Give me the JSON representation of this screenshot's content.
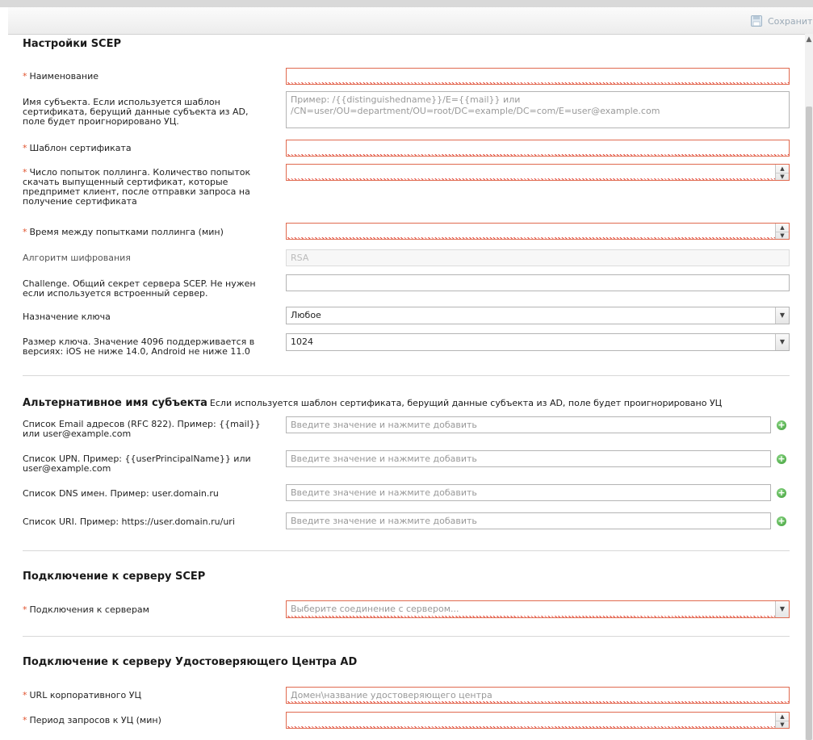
{
  "toolbar": {
    "save_label": "Сохранить"
  },
  "scep": {
    "title": "Настройки SCEP",
    "name_label": "Наименование",
    "subject_label": "Имя субъекта. Если используется шаблон сертификата, берущий данные субъекта из AD, поле будет проигнорировано УЦ.",
    "subject_placeholder": "Пример: /{{distinguishedname}}/E={{mail}} или /CN=user/OU=department/OU=root/DC=example/DC=com/E=user@example.com",
    "template_label": "Шаблон сертификата",
    "polling_attempts_label": "Число попыток поллинга. Количество попыток скачать выпущенный сертификат, которые предпримет клиент, после отправки запроса на получение сертификата",
    "polling_interval_label": "Время между попытками поллинга (мин)",
    "algorithm_label": "Алгоритм шифрования",
    "algorithm_value": "RSA",
    "challenge_label": "Challenge. Общий секрет сервера SCEP. Не нужен если используется встроенный сервер.",
    "key_purpose_label": "Назначение ключа",
    "key_purpose_value": "Любое",
    "key_size_label": "Размер ключа. Значение 4096 поддерживается в версиях: iOS не ниже 14.0, Android не ниже 11.0",
    "key_size_value": "1024"
  },
  "san": {
    "title": "Альтернативное имя субъекта",
    "note": "Если используется шаблон сертификата, берущий данные субъекта из AD, поле будет проигнорировано УЦ",
    "placeholder": "Введите значение и нажмите добавить",
    "email_label": "Список Email адресов (RFC 822). Пример: {{mail}} или user@example.com",
    "upn_label": "Список UPN. Пример: {{userPrincipalName}} или user@example.com",
    "dns_label": "Список DNS имен. Пример: user.domain.ru",
    "uri_label": "Список URI. Пример: https://user.domain.ru/uri"
  },
  "server": {
    "title": "Подключение к серверу SCEP",
    "connections_label": "Подключения к серверам",
    "connections_placeholder": "Выберите соединение с сервером..."
  },
  "ca": {
    "title": "Подключение к серверу Удостоверяющего Центра AD",
    "url_label": "URL корпоративного УЦ",
    "url_placeholder": "Домен\\название удостоверяющего центра",
    "period_label": "Период запросов к УЦ (мин)"
  },
  "required_marker": "*"
}
